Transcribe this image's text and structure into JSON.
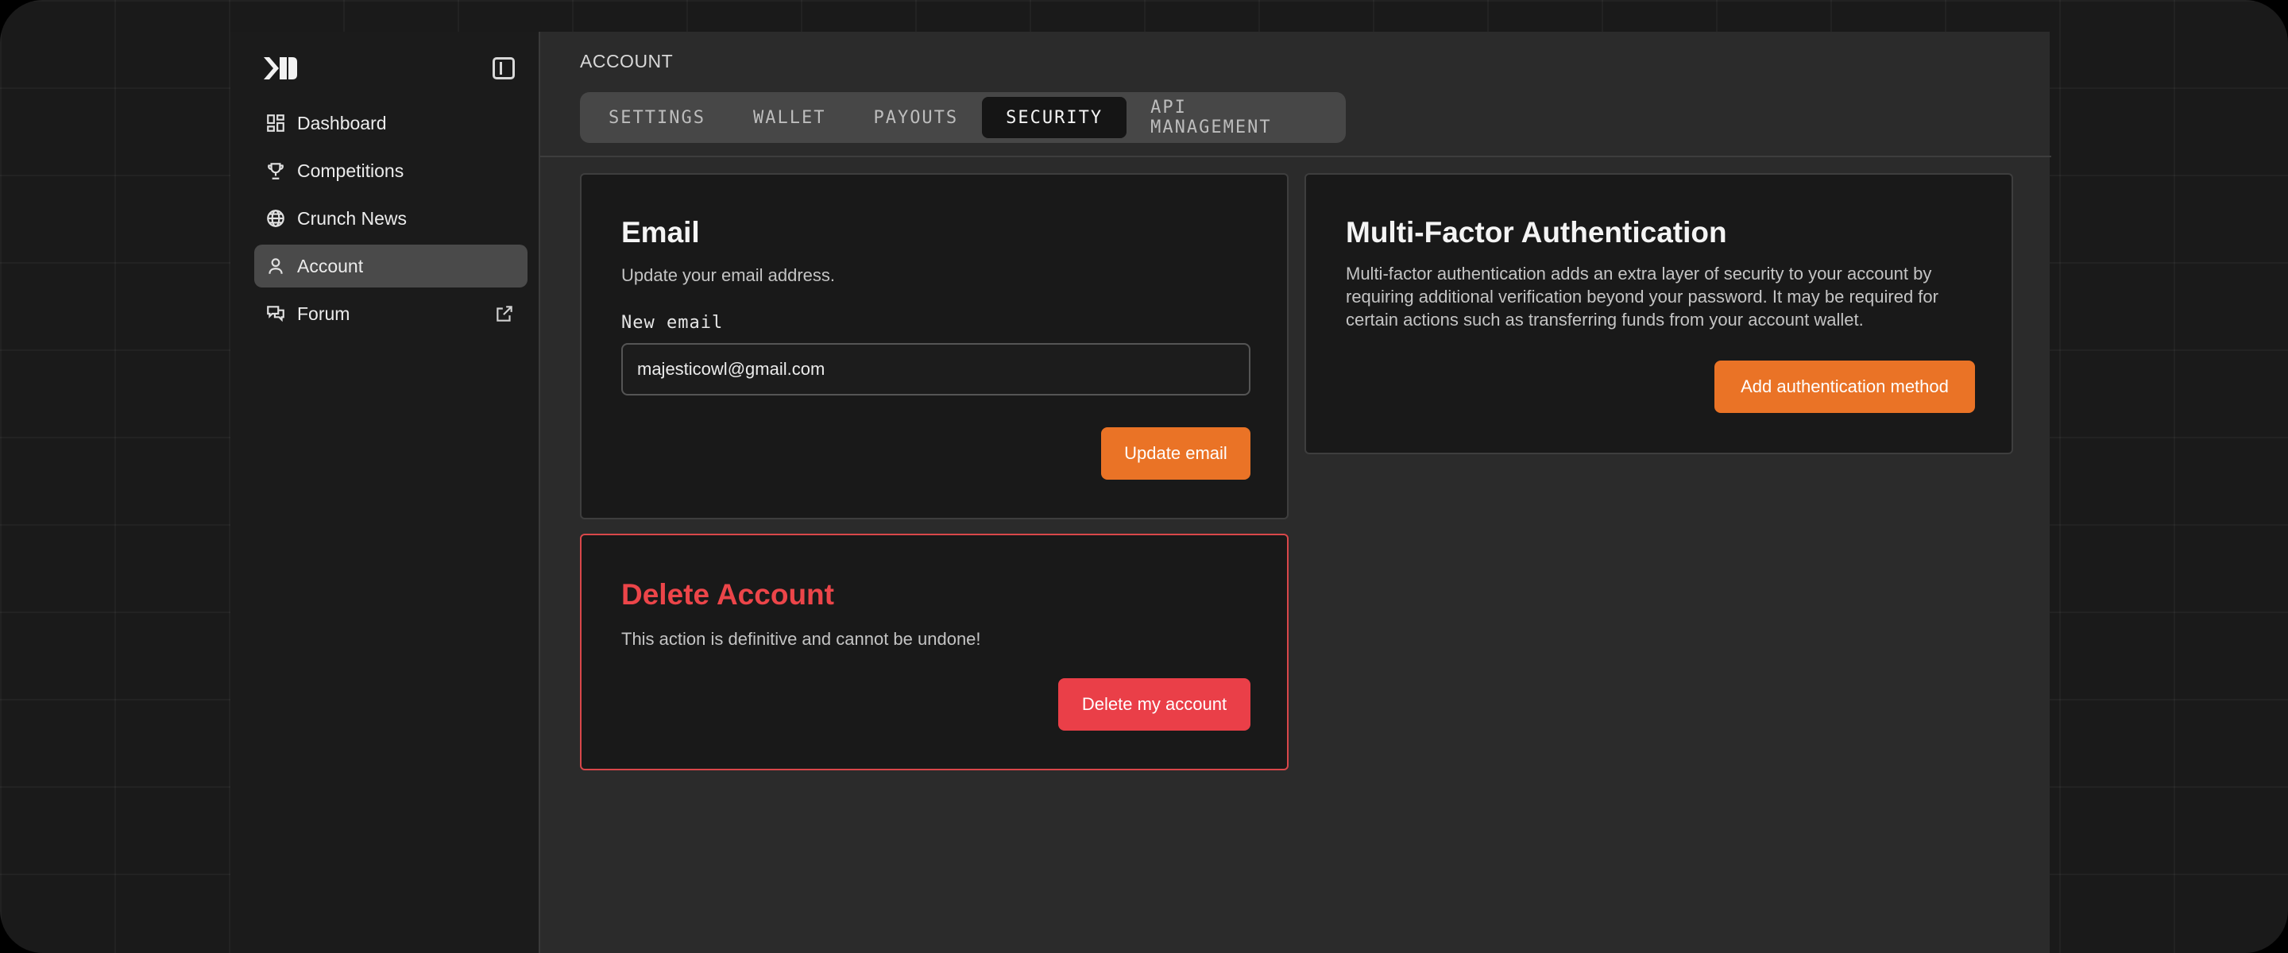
{
  "sidebar": {
    "items": [
      {
        "label": "Dashboard",
        "icon": "dashboard-icon"
      },
      {
        "label": "Competitions",
        "icon": "trophy-icon"
      },
      {
        "label": "Crunch News",
        "icon": "globe-icon"
      },
      {
        "label": "Account",
        "icon": "user-icon",
        "active": true
      },
      {
        "label": "Forum",
        "icon": "chat-icon",
        "external": true
      }
    ]
  },
  "header": {
    "breadcrumb": "ACCOUNT",
    "tabs": [
      "SETTINGS",
      "WALLET",
      "PAYOUTS",
      "SECURITY",
      "API MANAGEMENT"
    ],
    "active_tab": "SECURITY"
  },
  "email_card": {
    "title": "Email",
    "description": "Update your email address.",
    "field_label": "New email",
    "field_value": "majesticowl@gmail.com",
    "button": "Update email"
  },
  "mfa_card": {
    "title": "Multi-Factor Authentication",
    "description": "Multi-factor authentication adds an extra layer of security to your account by requiring additional verification beyond your password. It may be required for certain actions such as transferring funds from your account wallet.",
    "button": "Add authentication method"
  },
  "delete_card": {
    "title": "Delete Account",
    "description": "This action is definitive and cannot be undone!",
    "button": "Delete my account"
  },
  "colors": {
    "accent_orange": "#ea7326",
    "danger_red": "#ea3f48",
    "active_nav": "#4a4a4a"
  }
}
